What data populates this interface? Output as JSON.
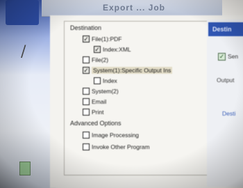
{
  "window": {
    "title": "Export ... Job"
  },
  "destination_group": {
    "title": "Destination",
    "items": [
      {
        "label": "File(1):PDF",
        "checked": true,
        "indent": 0
      },
      {
        "label": "Index:XML",
        "checked": true,
        "indent": 1
      },
      {
        "label": "File(2)",
        "checked": false,
        "indent": 0
      },
      {
        "label": "System(1):Specific Output Ins",
        "checked": true,
        "indent": 0,
        "highlighted": true
      },
      {
        "label": "Index",
        "checked": false,
        "indent": 1
      },
      {
        "label": "System(2)",
        "checked": false,
        "indent": 0
      },
      {
        "label": "Email",
        "checked": false,
        "indent": 0
      },
      {
        "label": "Print",
        "checked": false,
        "indent": 0
      }
    ]
  },
  "advanced_group": {
    "title": "Advanced Options",
    "items": [
      {
        "label": "Image Processing",
        "checked": false
      },
      {
        "label": "Invoke Other Program",
        "checked": false
      }
    ]
  },
  "right_panel": {
    "tab_label": "Destin",
    "checkbox_label": "Sen",
    "checkbox_checked": true,
    "output_label": "Output",
    "link_label": "Desti"
  },
  "colors": {
    "accent_blue": "#2f55b3",
    "dialog_bg": "#f4f3ef",
    "highlight_bg": "#e2dcc6"
  }
}
